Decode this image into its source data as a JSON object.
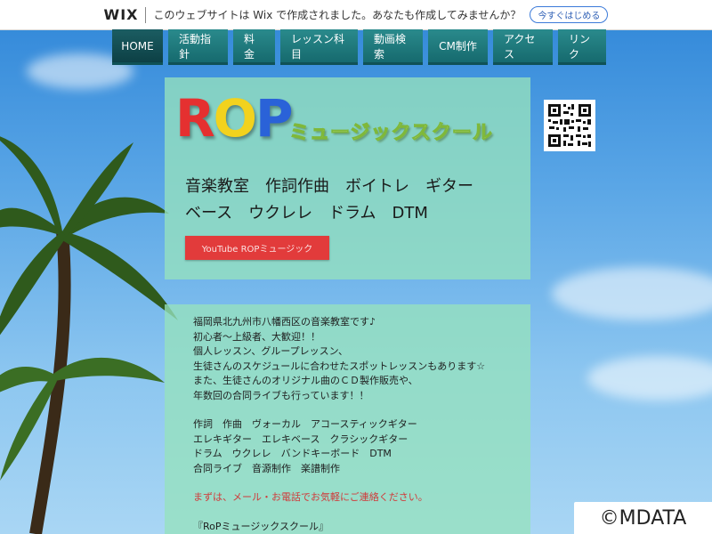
{
  "wix_bar": {
    "logo": "WIX",
    "message": "このウェブサイトは Wix で作成されました。あなたも作成してみませんか？",
    "cta": "今すぐはじめる"
  },
  "nav": {
    "items": [
      {
        "label": "HOME",
        "active": true
      },
      {
        "label": "活動指針"
      },
      {
        "label": "料金"
      },
      {
        "label": "レッスン科目"
      },
      {
        "label": "動画検索"
      },
      {
        "label": "CM制作"
      },
      {
        "label": "アクセス"
      },
      {
        "label": "リンク"
      }
    ]
  },
  "hero": {
    "logo_r": "R",
    "logo_o": "O",
    "logo_p": "P",
    "logo_sub": "ミュージックスクール",
    "subjects_line1": "音楽教室　作詞作曲　ボイトレ　ギター",
    "subjects_line2": "ベース　ウクレレ　ドラム　DTM",
    "youtube_button": "YouTube ROPミュージック"
  },
  "intro": {
    "lines": [
      "福岡県北九州市八幡西区の音楽教室です♪",
      "初心者～上級者、大歓迎！！",
      "個人レッスン、グループレッスン、",
      "生徒さんのスケジュールに合わせたスポットレッスンもあります☆",
      "また、生徒さんのオリジナル曲のＣＤ製作販売や、",
      "年数回の合同ライブも行っています！！"
    ],
    "courses": [
      "作詞　作曲　ヴォーカル　アコースティックギター",
      "エレキギター　エレキベース　クラシックギター",
      "ドラム　ウクレレ　バンドキーボード　DTM",
      "合同ライブ　音源制作　楽譜制作"
    ],
    "contact": "まずは、メール・お電話でお気軽にご連絡ください。",
    "school_name": "『RoPミュージックスクール』"
  },
  "watermark": "©MDATA",
  "colors": {
    "nav": "#166a6e",
    "panel": "#96e1be",
    "youtube": "#e23b3b",
    "logo_red": "#e53030",
    "logo_yellow": "#f2d21e",
    "logo_blue": "#2a62d8"
  }
}
